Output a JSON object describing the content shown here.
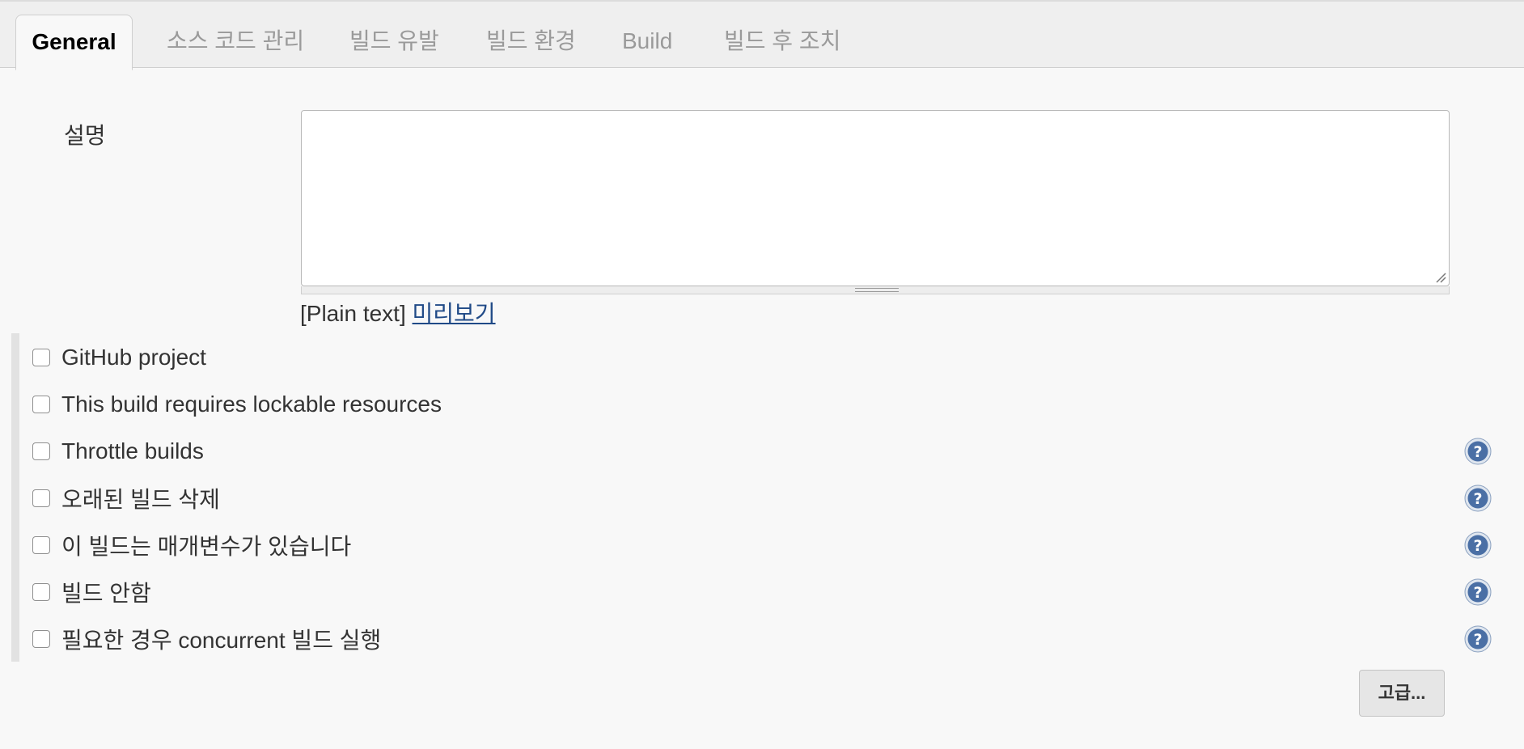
{
  "tabs": [
    {
      "label": "General",
      "active": true
    },
    {
      "label": "소스 코드 관리",
      "active": false
    },
    {
      "label": "빌드 유발",
      "active": false
    },
    {
      "label": "빌드 환경",
      "active": false
    },
    {
      "label": "Build",
      "active": false
    },
    {
      "label": "빌드 후 조치",
      "active": false
    }
  ],
  "description": {
    "label": "설명",
    "value": "",
    "format_text": "[Plain text]",
    "preview_link": "미리보기"
  },
  "options": [
    {
      "label": "GitHub project",
      "checked": false,
      "help_icon": false
    },
    {
      "label": "This build requires lockable resources",
      "checked": false,
      "help_icon": false
    },
    {
      "label": "Throttle builds",
      "checked": false,
      "help_icon": true
    },
    {
      "label": "오래된 빌드 삭제",
      "checked": false,
      "help_icon": true
    },
    {
      "label": "이 빌드는 매개변수가 있습니다",
      "checked": false,
      "help_icon": true
    },
    {
      "label": "빌드 안함",
      "checked": false,
      "help_icon": true
    },
    {
      "label": "필요한 경우 concurrent 빌드 실행",
      "checked": false,
      "help_icon": true
    }
  ],
  "advanced_button": {
    "label": "고급..."
  },
  "colors": {
    "link": "#204a87",
    "help_icon": "#4a6fa5",
    "background": "#f8f8f8"
  },
  "icons": {
    "help": "question-mark-circle-icon"
  }
}
